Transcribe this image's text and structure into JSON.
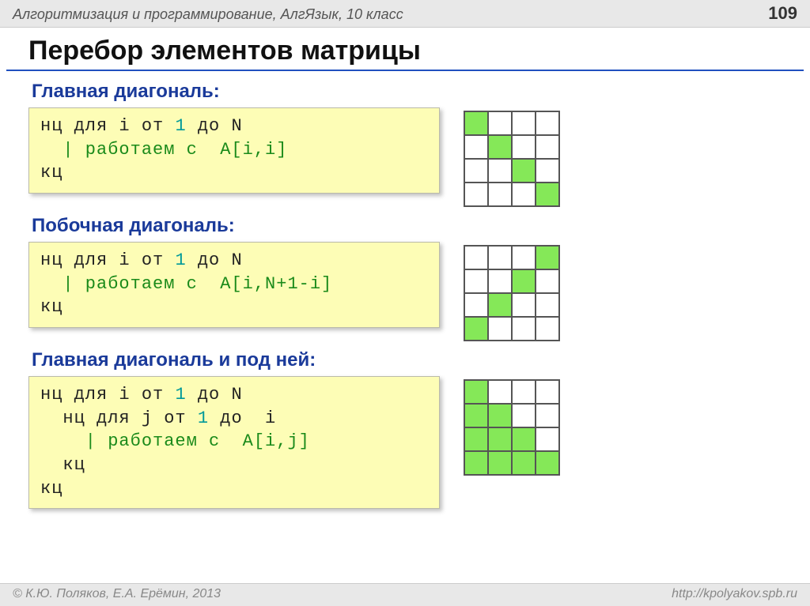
{
  "header": {
    "title": "Алгоритмизация и программирование, АлгЯзык, 10 класс",
    "page": "109"
  },
  "title": "Перебор элементов матрицы",
  "sections": [
    {
      "subtitle": "Главная диагональ:",
      "code": {
        "l1a": "нц для i от ",
        "l1n": "1",
        "l1b": " до N",
        "l2": "  | работаем с  A[i,i]",
        "l3": "кц"
      },
      "grid": [
        [
          1,
          0,
          0,
          0
        ],
        [
          0,
          1,
          0,
          0
        ],
        [
          0,
          0,
          1,
          0
        ],
        [
          0,
          0,
          0,
          1
        ]
      ]
    },
    {
      "subtitle": "Побочная диагональ:",
      "code": {
        "l1a": "нц для i от ",
        "l1n": "1",
        "l1b": " до N",
        "l2": "  | работаем с  A[i,N+1-i]",
        "l3": "кц"
      },
      "grid": [
        [
          0,
          0,
          0,
          1
        ],
        [
          0,
          0,
          1,
          0
        ],
        [
          0,
          1,
          0,
          0
        ],
        [
          1,
          0,
          0,
          0
        ]
      ]
    },
    {
      "subtitle": "Главная диагональ и под ней:",
      "code": {
        "l1a": "нц для i от ",
        "l1n": "1",
        "l1b": " до N",
        "l2a": "  нц для j от ",
        "l2n": "1",
        "l2b": " до  i",
        "l3": "    | работаем с  A[i,j]",
        "l4": "  кц",
        "l5": "кц"
      },
      "grid": [
        [
          1,
          0,
          0,
          0
        ],
        [
          1,
          1,
          0,
          0
        ],
        [
          1,
          1,
          1,
          0
        ],
        [
          1,
          1,
          1,
          1
        ]
      ]
    }
  ],
  "footer": {
    "left": "© К.Ю. Поляков, Е.А. Ерёмин, 2013",
    "right": "http://kpolyakov.spb.ru"
  }
}
